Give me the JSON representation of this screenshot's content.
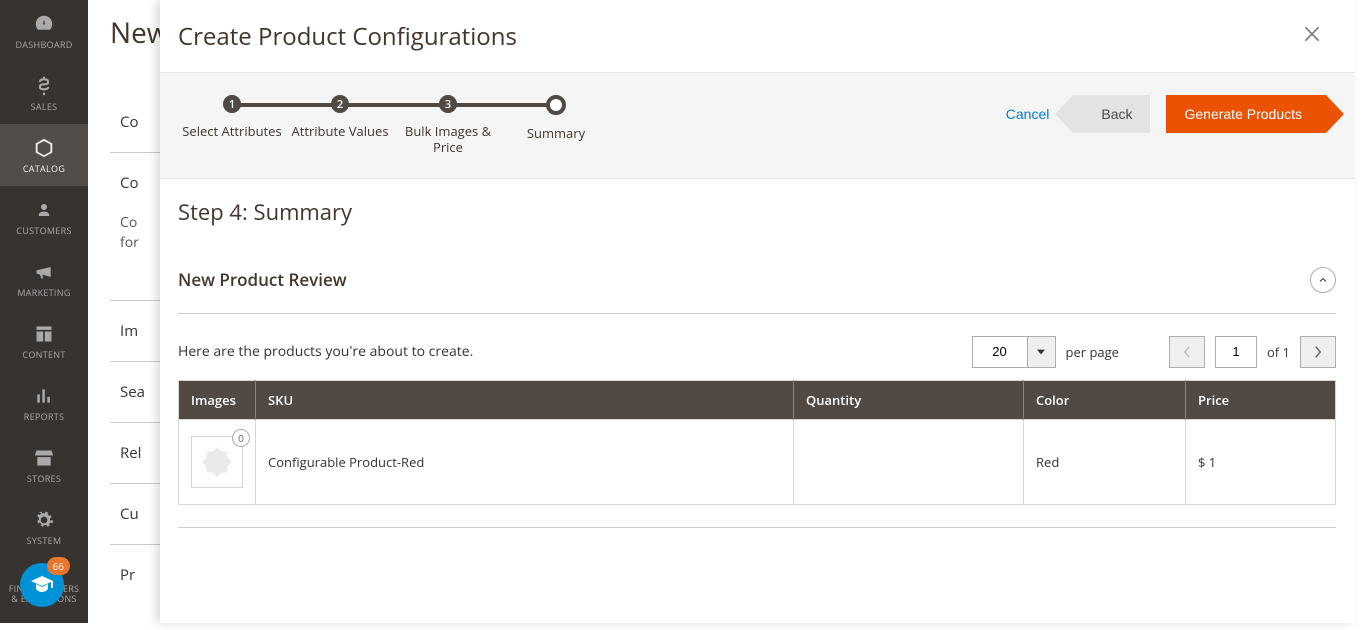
{
  "sidebar": {
    "items": [
      {
        "label": "DASHBOARD",
        "icon": "gauge"
      },
      {
        "label": "SALES",
        "icon": "dollar"
      },
      {
        "label": "CATALOG",
        "icon": "box",
        "active": true
      },
      {
        "label": "CUSTOMERS",
        "icon": "person"
      },
      {
        "label": "MARKETING",
        "icon": "megaphone"
      },
      {
        "label": "CONTENT",
        "icon": "layout"
      },
      {
        "label": "REPORTS",
        "icon": "bars"
      },
      {
        "label": "STORES",
        "icon": "store"
      },
      {
        "label": "SYSTEM",
        "icon": "gear"
      },
      {
        "label": "FIND PARTNERS & EXTENSIONS",
        "icon": "partners"
      }
    ],
    "badge": "66"
  },
  "bg": {
    "title": "New",
    "sections": [
      "Co",
      "Co",
      "Im",
      "Sea",
      "Rel",
      "Cu",
      "Pr"
    ],
    "note_l1": "Co",
    "note_l2": "for"
  },
  "modal": {
    "title": "Create Product Configurations",
    "steps": [
      {
        "num": "1",
        "label": "Select Attributes"
      },
      {
        "num": "2",
        "label": "Attribute Values"
      },
      {
        "num": "3",
        "label": "Bulk Images & Price"
      },
      {
        "num": "",
        "label": "Summary",
        "current": true
      }
    ],
    "actions": {
      "cancel": "Cancel",
      "back": "Back",
      "generate": "Generate Products"
    },
    "step_heading": "Step 4: Summary",
    "section_title": "New Product Review",
    "toolbar_note": "Here are the products you're about to create.",
    "pager": {
      "per_page_value": "20",
      "per_page_label": "per page",
      "page_value": "1",
      "of_label": "of 1"
    },
    "columns": {
      "images": "Images",
      "sku": "SKU",
      "quantity": "Quantity",
      "color": "Color",
      "price": "Price"
    },
    "rows": [
      {
        "img_count": "0",
        "sku": "Configurable Product-Red",
        "quantity": "",
        "color": "Red",
        "price": "$ 1"
      }
    ]
  }
}
